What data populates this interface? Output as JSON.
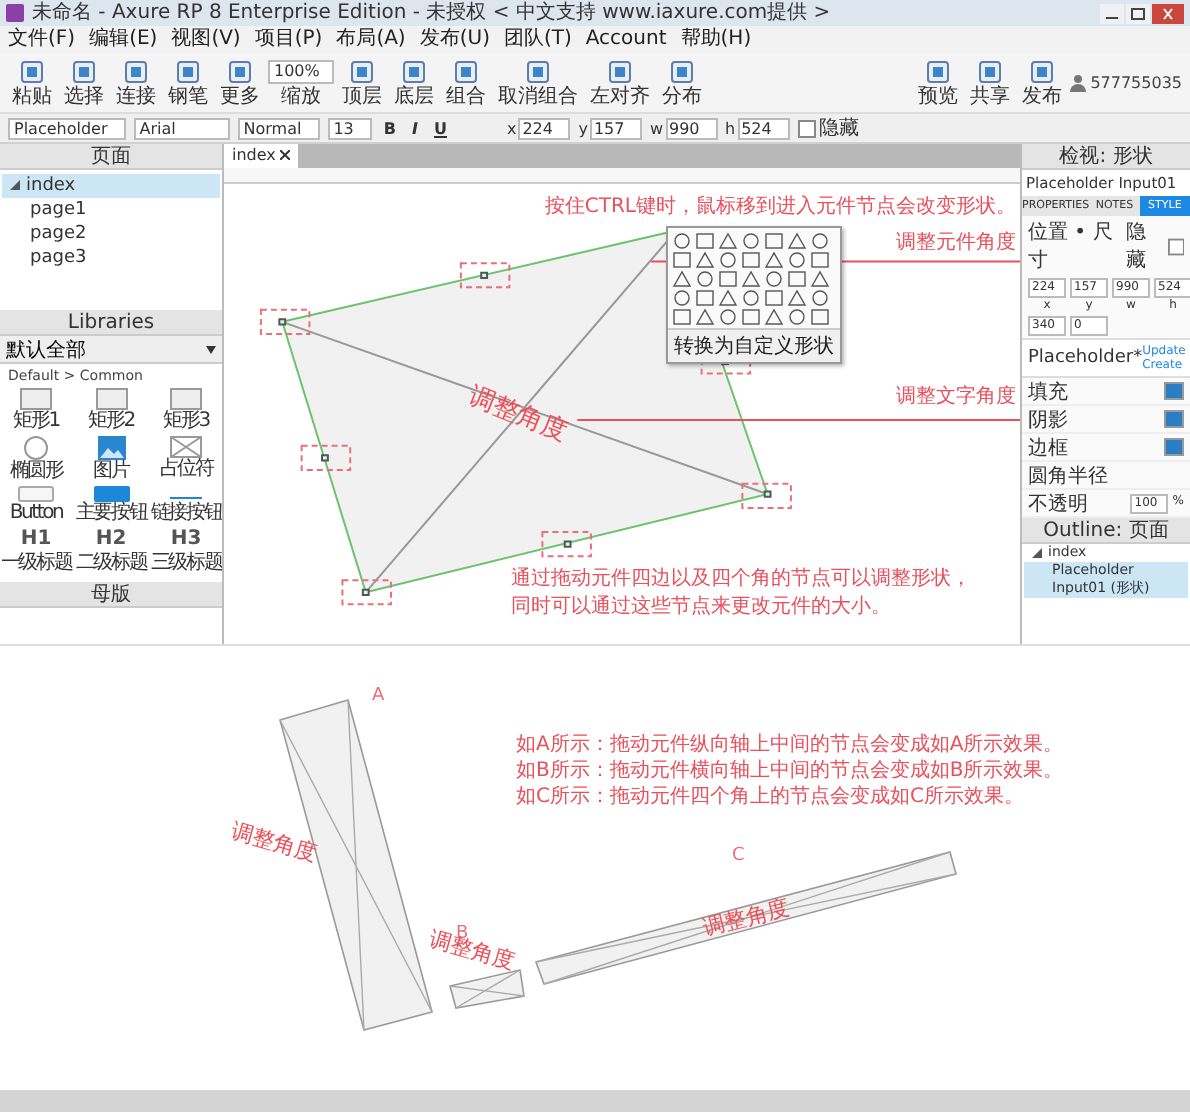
{
  "window": {
    "title": "未命名 - Axure RP 8 Enterprise Edition - 未授权 < 中文支持 www.iaxure.com提供 >"
  },
  "menu": [
    "文件(F)",
    "编辑(E)",
    "视图(V)",
    "项目(P)",
    "布局(A)",
    "发布(U)",
    "团队(T)",
    "Account",
    "帮助(H)"
  ],
  "toolbar": {
    "tools": [
      {
        "kind": "button",
        "label": "粘贴"
      },
      {
        "kind": "button",
        "label": "选择"
      },
      {
        "kind": "button",
        "label": "连接"
      },
      {
        "kind": "button",
        "label": "钢笔"
      },
      {
        "kind": "button",
        "label": "更多"
      },
      {
        "kind": "zoom",
        "value": "100%",
        "label": "缩放"
      },
      {
        "kind": "button",
        "label": "顶层"
      },
      {
        "kind": "button",
        "label": "底层"
      },
      {
        "kind": "button",
        "label": "组合"
      },
      {
        "kind": "button",
        "label": "取消组合"
      },
      {
        "kind": "button",
        "label": "左对齐"
      },
      {
        "kind": "button",
        "label": "分布"
      }
    ],
    "actions": [
      {
        "label": "预览"
      },
      {
        "label": "共享"
      },
      {
        "label": "发布"
      }
    ],
    "user": "577755035"
  },
  "format": {
    "style": "Placeholder",
    "font": "Arial",
    "weight": "Normal",
    "size": "13",
    "text_buttons": [
      "B",
      "I",
      "U"
    ],
    "fields": [
      {
        "label": "x",
        "value": "224"
      },
      {
        "label": "y",
        "value": "157"
      },
      {
        "label": "w",
        "value": "990"
      },
      {
        "label": "h",
        "value": "524"
      }
    ],
    "hidden_label": "隐藏",
    "hidden": false
  },
  "pages": {
    "title": "页面",
    "items": [
      {
        "label": "index",
        "selected": true,
        "children": [
          {
            "label": "page1",
            "selected": false
          },
          {
            "label": "page2",
            "selected": false
          },
          {
            "label": "page3",
            "selected": false
          }
        ]
      }
    ]
  },
  "libraries": {
    "title": "Libraries",
    "filter": "默认全部",
    "group": "Default > Common",
    "widgets": [
      {
        "kind": "box",
        "label": "矩形1"
      },
      {
        "kind": "box",
        "label": "矩形2"
      },
      {
        "kind": "box",
        "label": "矩形3"
      },
      {
        "kind": "ellipse",
        "label": "椭圆形"
      },
      {
        "kind": "image",
        "label": "图片"
      },
      {
        "kind": "placeholder",
        "label": "占位符"
      },
      {
        "kind": "button",
        "label": "Button"
      },
      {
        "kind": "primary",
        "label": "主要按钮"
      },
      {
        "kind": "link",
        "label": "链接按钮"
      },
      {
        "kind": "heading",
        "glyph": "H1",
        "label": "一级标题"
      },
      {
        "kind": "heading",
        "glyph": "H2",
        "label": "二级标题"
      },
      {
        "kind": "heading",
        "glyph": "H3",
        "label": "三级标题"
      }
    ]
  },
  "masters": {
    "title": "母版"
  },
  "canvas": {
    "tabs": [
      {
        "label": "index",
        "selected": true
      }
    ],
    "notes": [
      {
        "kind": "top",
        "text": "按住CTRL键时，鼠标移到进入元件节点会改变形状。"
      },
      {
        "kind": "angle",
        "text": "调整元件角度"
      },
      {
        "kind": "text_angle",
        "text": "调整文字角度"
      },
      {
        "kind": "bottom",
        "text": "通过拖动元件四边以及四个角的节点可以调整形状，"
      },
      {
        "kind": "bottom",
        "text": "同时可以通过这些节点来更改元件的大小。"
      }
    ],
    "shape_text": "调整角度",
    "shape_menu": {
      "action": "转换为自定义形状"
    }
  },
  "inspector": {
    "title": "检视: 形状",
    "name": "Placeholder Input01",
    "tabs": [
      {
        "label": "PROPERTIES",
        "selected": false
      },
      {
        "label": "NOTES",
        "selected": false
      },
      {
        "label": "STYLE",
        "selected": true
      }
    ],
    "position_title": "位置 • 尺寸",
    "hidden_label": "隐藏",
    "hidden": false,
    "fields": [
      {
        "label": "x",
        "value": "224"
      },
      {
        "label": "y",
        "value": "157"
      },
      {
        "label": "w",
        "value": "990"
      },
      {
        "label": "h",
        "value": "524"
      }
    ],
    "rotation": [
      {
        "value": "340"
      },
      {
        "value": "0"
      }
    ],
    "style": "Placeholder*",
    "style_links": [
      "Update",
      "Create"
    ],
    "rows": [
      "填充",
      "阴影",
      "边框",
      "圆角半径",
      "不透明"
    ],
    "opacity": "100",
    "opacity_unit": "%"
  },
  "outline": {
    "title": "Outline: 页面",
    "items": [
      {
        "label": "index",
        "selected": false,
        "children": [
          {
            "label": "Placeholder Input01 (形状)",
            "selected": true
          }
        ]
      }
    ]
  },
  "examples": {
    "labels": [
      "A",
      "B",
      "C"
    ],
    "shape_text": [
      "调整角度",
      "调整角度",
      "调整角度"
    ],
    "notes": [
      "如A所示：拖动元件纵向轴上中间的节点会变成如A所示效果。",
      "如B所示：拖动元件横向轴上中间的节点会变成如B所示效果。",
      "如C所示：拖动元件四个角上的节点会变成如C所示效果。"
    ]
  }
}
